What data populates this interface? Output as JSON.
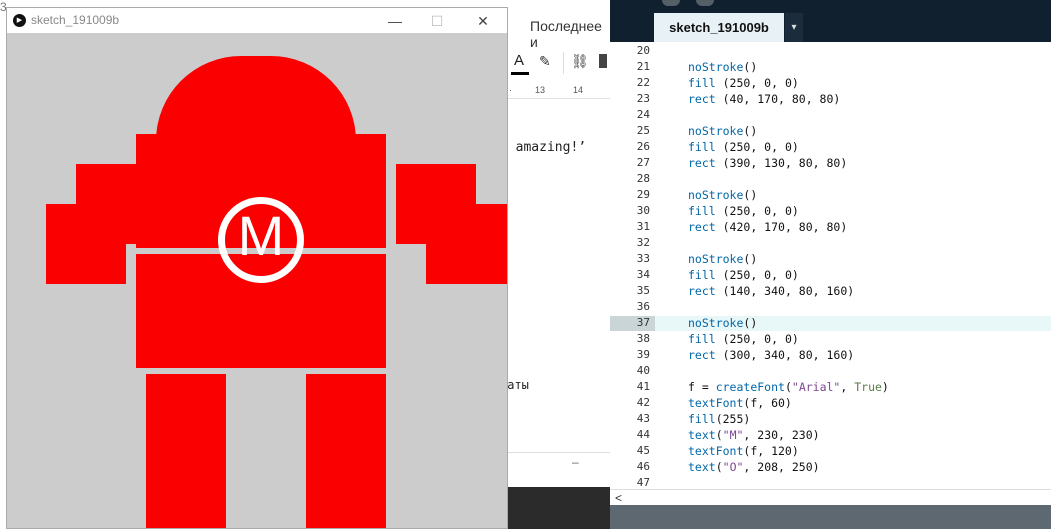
{
  "background_doc": {
    "menu_item": "Последнее и",
    "ruler_13": "13",
    "ruler_14": "14",
    "doc_line1": "s amazing!’",
    "doc_line2": "наты",
    "toolbar_a": "A",
    "top_left_text": "3"
  },
  "sketch_window": {
    "title": "sketch_191009b",
    "minimize": "—",
    "maximize": "☐",
    "close": "✕",
    "canvas_bg": "#cccccc",
    "body_color": "#fa0000",
    "emblem_letter": "M"
  },
  "editor": {
    "tab_label": "sketch_191009b",
    "tab_menu": "▾",
    "scroll_left": "<",
    "lines": [
      {
        "n": "20",
        "parts": []
      },
      {
        "n": "21",
        "parts": [
          {
            "t": "noStroke",
            "c": "kw"
          },
          {
            "t": "()",
            "c": ""
          }
        ]
      },
      {
        "n": "22",
        "parts": [
          {
            "t": "fill",
            "c": "kw"
          },
          {
            "t": " (250, 0, 0)",
            "c": ""
          }
        ]
      },
      {
        "n": "23",
        "parts": [
          {
            "t": "rect",
            "c": "kw"
          },
          {
            "t": " (40, 170, 80, 80)",
            "c": ""
          }
        ]
      },
      {
        "n": "24",
        "parts": []
      },
      {
        "n": "25",
        "parts": [
          {
            "t": "noStroke",
            "c": "kw"
          },
          {
            "t": "()",
            "c": ""
          }
        ]
      },
      {
        "n": "26",
        "parts": [
          {
            "t": "fill",
            "c": "kw"
          },
          {
            "t": " (250, 0, 0)",
            "c": ""
          }
        ]
      },
      {
        "n": "27",
        "parts": [
          {
            "t": "rect",
            "c": "kw"
          },
          {
            "t": " (390, 130, 80, 80)",
            "c": ""
          }
        ]
      },
      {
        "n": "28",
        "parts": []
      },
      {
        "n": "29",
        "parts": [
          {
            "t": "noStroke",
            "c": "kw"
          },
          {
            "t": "()",
            "c": ""
          }
        ]
      },
      {
        "n": "30",
        "parts": [
          {
            "t": "fill",
            "c": "kw"
          },
          {
            "t": " (250, 0, 0)",
            "c": ""
          }
        ]
      },
      {
        "n": "31",
        "parts": [
          {
            "t": "rect",
            "c": "kw"
          },
          {
            "t": " (420, 170, 80, 80)",
            "c": ""
          }
        ]
      },
      {
        "n": "32",
        "parts": []
      },
      {
        "n": "33",
        "parts": [
          {
            "t": "noStroke",
            "c": "kw"
          },
          {
            "t": "()",
            "c": ""
          }
        ]
      },
      {
        "n": "34",
        "parts": [
          {
            "t": "fill",
            "c": "kw"
          },
          {
            "t": " (250, 0, 0)",
            "c": ""
          }
        ]
      },
      {
        "n": "35",
        "parts": [
          {
            "t": "rect",
            "c": "kw"
          },
          {
            "t": " (140, 340, 80, 160)",
            "c": ""
          }
        ]
      },
      {
        "n": "36",
        "parts": []
      },
      {
        "n": "37",
        "parts": [
          {
            "t": "noStroke",
            "c": "kw"
          },
          {
            "t": "()",
            "c": ""
          }
        ]
      },
      {
        "n": "38",
        "parts": [
          {
            "t": "fill",
            "c": "kw"
          },
          {
            "t": " (250, 0, 0)",
            "c": ""
          }
        ]
      },
      {
        "n": "39",
        "parts": [
          {
            "t": "rect",
            "c": "kw"
          },
          {
            "t": " (300, 340, 80, 160)",
            "c": ""
          }
        ]
      },
      {
        "n": "40",
        "parts": []
      },
      {
        "n": "41",
        "parts": [
          {
            "t": "f = ",
            "c": ""
          },
          {
            "t": "createFont",
            "c": "kw"
          },
          {
            "t": "(",
            "c": ""
          },
          {
            "t": "\"Arial\"",
            "c": "str"
          },
          {
            "t": ", ",
            "c": ""
          },
          {
            "t": "True",
            "c": "lit"
          },
          {
            "t": ")",
            "c": ""
          }
        ]
      },
      {
        "n": "42",
        "parts": [
          {
            "t": "textFont",
            "c": "kw"
          },
          {
            "t": "(f, 60)",
            "c": ""
          }
        ]
      },
      {
        "n": "43",
        "parts": [
          {
            "t": "fill",
            "c": "kw"
          },
          {
            "t": "(255)",
            "c": ""
          }
        ]
      },
      {
        "n": "44",
        "parts": [
          {
            "t": "text",
            "c": "kw"
          },
          {
            "t": "(",
            "c": ""
          },
          {
            "t": "\"M\"",
            "c": "str"
          },
          {
            "t": ", 230, 230)",
            "c": ""
          }
        ]
      },
      {
        "n": "45",
        "parts": [
          {
            "t": "textFont",
            "c": "kw"
          },
          {
            "t": "(f, 120)",
            "c": ""
          }
        ]
      },
      {
        "n": "46",
        "parts": [
          {
            "t": "text",
            "c": "kw"
          },
          {
            "t": "(",
            "c": ""
          },
          {
            "t": "\"O\"",
            "c": "str"
          },
          {
            "t": ", 208, 250)",
            "c": ""
          }
        ]
      },
      {
        "n": "47",
        "parts": []
      }
    ]
  }
}
